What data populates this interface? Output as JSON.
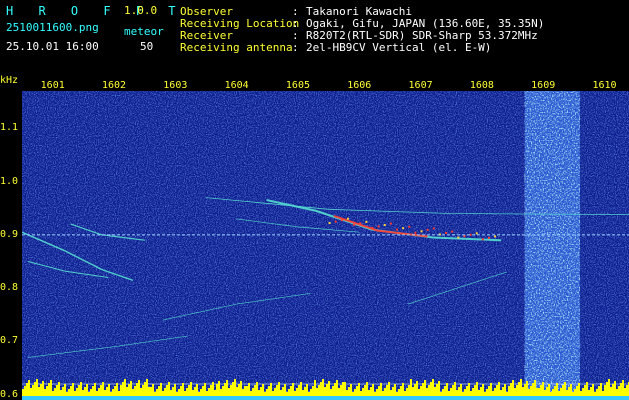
{
  "header": {
    "app_name": "H R O F F T",
    "version": "1.0.0",
    "filename": "2510011600.png",
    "datetime": "25.10.01 16:00",
    "meteor_label": "meteor",
    "meteor_count": "50",
    "fields": [
      {
        "label": "Observer",
        "sep": ":",
        "value": "Takanori Kawachi"
      },
      {
        "label": "Receiving Location",
        "sep": ":",
        "value": "Ogaki, Gifu, JAPAN (136.60E, 35.35N)"
      },
      {
        "label": "Receiver",
        "sep": ":",
        "value": "R820T2(RTL-SDR) SDR-Sharp 53.372MHz"
      },
      {
        "label": "Receiving antenna",
        "sep": ":",
        "value": "2el-HB9CV Vertical (el. E-W)"
      }
    ]
  },
  "chart_data": {
    "type": "heatmap",
    "y_unit": "kHz",
    "x_ticks": [
      "1601",
      "1602",
      "1603",
      "1604",
      "1605",
      "1606",
      "1607",
      "1608",
      "1609",
      "1610"
    ],
    "y_ticks": [
      "1.1",
      "1.0",
      "0.9",
      "0.8",
      "0.7",
      "0.6"
    ],
    "xlim": [
      1600.5,
      1610.4
    ],
    "ylim": [
      0.59,
      1.17
    ],
    "carrier_khz": 0.9,
    "interference_band_x": [
      1608.7,
      1609.6
    ],
    "colors": {
      "background": "#0a1a8c",
      "noise": "#2d5fd9",
      "echo": "#55e0d0",
      "hot": "#ff3b2f",
      "baseline": "#ffff00",
      "axis": "#ffff33"
    }
  }
}
